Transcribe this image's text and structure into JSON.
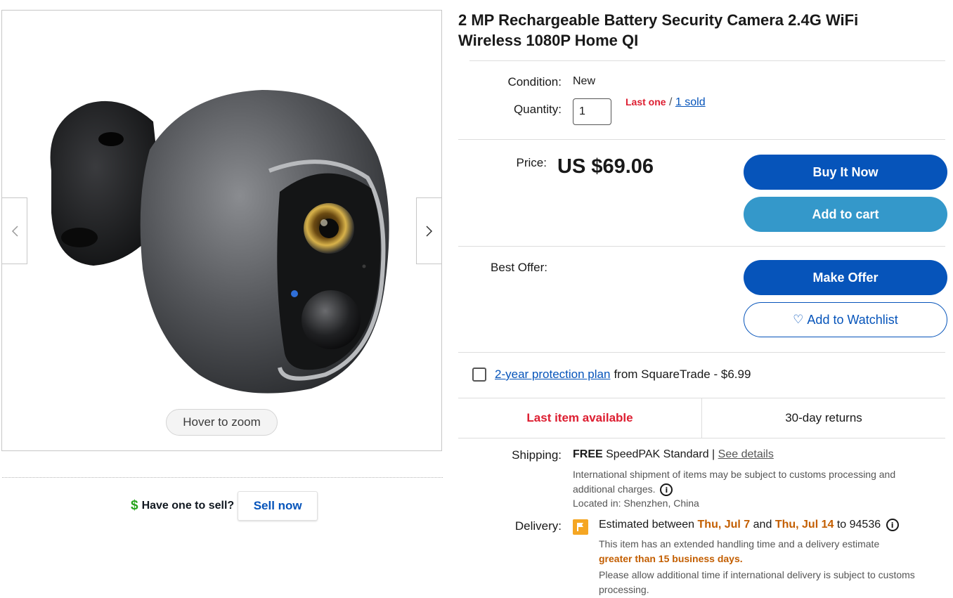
{
  "gallery": {
    "zoom_hint": "Hover to zoom",
    "prev_icon": "chevron-left-icon",
    "next_icon": "chevron-right-icon"
  },
  "sell": {
    "question": "Have one to sell?",
    "button_label": "Sell now",
    "icon": "dollar-icon"
  },
  "listing": {
    "title": "2 MP Rechargeable Battery Security Camera 2.4G WiFi Wireless 1080P Home QI",
    "condition_label": "Condition:",
    "condition_value": "New",
    "quantity_label": "Quantity:",
    "quantity_value": "1",
    "last_one": "Last one",
    "slash": "/",
    "sold_link": "1 sold",
    "price_label": "Price:",
    "price_value": "US $69.06",
    "best_offer_label": "Best Offer:"
  },
  "buttons": {
    "buy_now": "Buy It Now",
    "add_to_cart": "Add to cart",
    "make_offer": "Make Offer",
    "add_to_watchlist": "Add to Watchlist"
  },
  "protection": {
    "link": "2-year protection plan",
    "rest": "from SquareTrade - $6.99"
  },
  "status": {
    "availability": "Last item available",
    "returns": "30-day returns"
  },
  "shipping": {
    "label": "Shipping:",
    "free": "FREE",
    "method": "SpeedPAK Standard |",
    "see_details": "See details",
    "note": "International shipment of items may be subject to customs processing and additional charges.",
    "location": "Located in: Shenzhen, China"
  },
  "delivery": {
    "label": "Delivery:",
    "prefix": "Estimated between",
    "date_start": "Thu, Jul 7",
    "and": "and",
    "date_end": "Thu, Jul 14",
    "to_zip": "to 94536",
    "note": "This item has an extended handling time and a delivery estimate",
    "note_highlight": "greater than 15 business days.",
    "note2": "Please allow additional time if international delivery is subject to customs processing."
  },
  "colors": {
    "primary_blue": "#0654ba",
    "cart_blue": "#3498ca",
    "alert_red": "#dd1e31",
    "date_orange": "#c35e00",
    "success_green": "#26a41c"
  }
}
